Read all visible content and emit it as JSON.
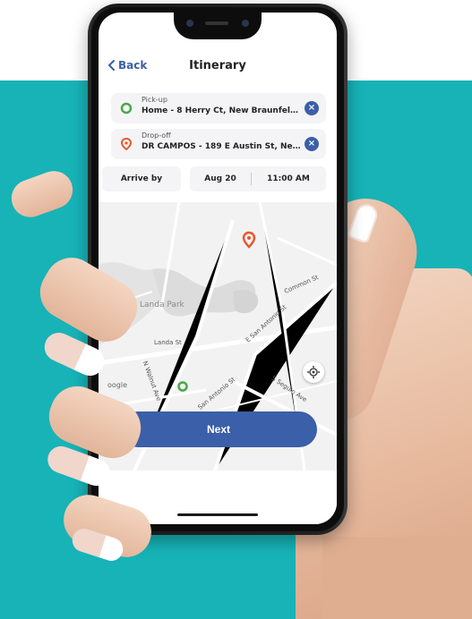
{
  "header": {
    "back_label": "Back",
    "title": "Itinerary"
  },
  "pickup": {
    "label": "Pick-up",
    "value": "Home - 8 Herry Ct, New Braunfels, Tx,..."
  },
  "dropoff": {
    "label": "Drop-off",
    "value": "DR CAMPOS - 189 E Austin St, New Br..."
  },
  "schedule": {
    "mode_label": "Arrive by",
    "date": "Aug 20",
    "time": "11:00 AM"
  },
  "map": {
    "labels": {
      "park": "Landa Park",
      "landa_st": "Landa St",
      "n_walnut": "N Walnut Ave",
      "san_antonio": "San Antonio St",
      "e_san_antonio": "E San Antonio St",
      "commen": "Common St",
      "s_seguin": "S Seguin Ave",
      "google": "oogle"
    }
  },
  "actions": {
    "next_label": "Next"
  },
  "colors": {
    "accent": "#3b5fa8",
    "teal": "#17b3b7",
    "pickup_green": "#4aa84a",
    "dropoff_orange": "#e8572e"
  },
  "icons": {
    "back": "chevron-left-icon",
    "pickup": "green-circle-marker-icon",
    "dropoff": "orange-pin-icon",
    "clear": "close-icon",
    "locate": "crosshair-icon"
  }
}
